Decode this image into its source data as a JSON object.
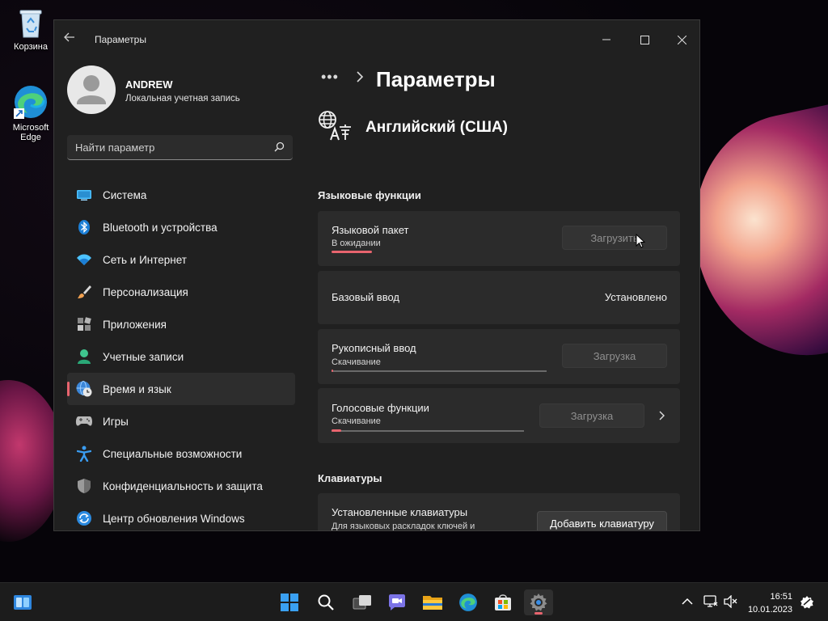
{
  "desktop": {
    "icons": [
      {
        "label": "Корзина",
        "icon": "recycle-bin-icon"
      },
      {
        "label": "Microsoft Edge",
        "icon": "edge-icon"
      }
    ]
  },
  "window": {
    "title": "Параметры",
    "controls": [
      "minimize",
      "maximize",
      "close"
    ]
  },
  "profile": {
    "name": "ANDREW",
    "account_type": "Локальная учетная запись"
  },
  "search": {
    "placeholder": "Найти параметр"
  },
  "sidebar": {
    "items": [
      {
        "label": "Система",
        "icon": "system-icon",
        "active": false
      },
      {
        "label": "Bluetooth и устройства",
        "icon": "bluetooth-icon",
        "active": false
      },
      {
        "label": "Сеть и Интернет",
        "icon": "wifi-icon",
        "active": false
      },
      {
        "label": "Персонализация",
        "icon": "brush-icon",
        "active": false
      },
      {
        "label": "Приложения",
        "icon": "apps-icon",
        "active": false
      },
      {
        "label": "Учетные записи",
        "icon": "accounts-icon",
        "active": false
      },
      {
        "label": "Время и язык",
        "icon": "time-language-icon",
        "active": true
      },
      {
        "label": "Игры",
        "icon": "gamepad-icon",
        "active": false
      },
      {
        "label": "Специальные возможности",
        "icon": "accessibility-icon",
        "active": false
      },
      {
        "label": "Конфиденциальность и защита",
        "icon": "shield-icon",
        "active": false
      },
      {
        "label": "Центр обновления Windows",
        "icon": "update-icon",
        "active": false
      }
    ]
  },
  "content": {
    "breadcrumb_dots": "•••",
    "page_title": "Параметры",
    "language_title": "Английский (США)",
    "section_features": "Языковые функции",
    "features": [
      {
        "title": "Языковой пакет",
        "status": "В ожидании",
        "button": "Загрузить",
        "progress": 0.23,
        "button_enabled": false
      },
      {
        "title": "Базовый ввод",
        "value": "Установлено"
      },
      {
        "title": "Рукописный ввод",
        "status": "Скачивание",
        "button": "Загрузка",
        "progress": 0.0,
        "button_enabled": false
      },
      {
        "title": "Голосовые функции",
        "status": "Скачивание",
        "button": "Загрузка",
        "progress": 0.05,
        "button_enabled": false,
        "has_chevron": true
      }
    ],
    "section_keyboards": "Клавиатуры",
    "keyboards": {
      "title": "Установленные клавиатуры",
      "subtitle": "Для языковых раскладок ключей и",
      "button": "Добавить клавиатуру"
    }
  },
  "taskbar": {
    "icons": [
      "widgets-icon",
      "start-icon",
      "search-icon",
      "task-view-icon",
      "teams-chat-icon",
      "file-explorer-icon",
      "edge-icon",
      "store-icon",
      "settings-icon"
    ],
    "active": "settings-icon",
    "time": "16:51",
    "date": "10.01.2023"
  },
  "colors": {
    "accent": "#e8646e",
    "window_bg": "#202020",
    "card_bg": "#2b2b2b",
    "taskbar_bg": "#1c1c1c"
  }
}
